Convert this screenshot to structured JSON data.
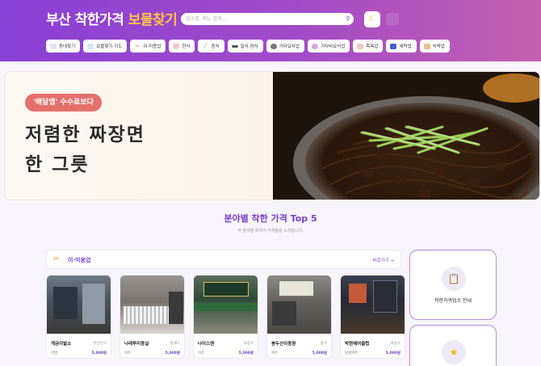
{
  "header": {
    "logo_main": "부산 착한가격",
    "logo_accent": "보물찾기",
    "search_placeholder": "업소명, 메뉴 검색...",
    "search_icon": "search-icon",
    "dark_mode_icon": "moon-icon"
  },
  "categories": [
    {
      "label": "동네찾기",
      "icon": "map-icon",
      "color": "#7b8fd6"
    },
    {
      "label": "보물찾기 지도",
      "icon": "treasure-map-icon",
      "color": "#5a9be6"
    },
    {
      "label": "이·미용업",
      "icon": "scissors-icon",
      "color": "#e69a2e"
    },
    {
      "label": "한식",
      "icon": "rice-bowl-icon",
      "color": "#d05a5a"
    },
    {
      "label": "중식",
      "icon": "chopsticks-icon",
      "color": "#d06f9b"
    },
    {
      "label": "일식·양식",
      "icon": "plate-icon",
      "color": "#5a5a5a"
    },
    {
      "label": "기타요식업",
      "icon": "dish-icon",
      "color": "#6a6a6a"
    },
    {
      "label": "기타비요식업",
      "icon": "shop-icon",
      "color": "#b06ac0"
    },
    {
      "label": "목욕업",
      "icon": "bath-icon",
      "color": "#d68a8a"
    },
    {
      "label": "세탁업",
      "icon": "laundry-icon",
      "color": "#4a5ad0"
    },
    {
      "label": "숙박업",
      "icon": "bed-icon",
      "color": "#c07a3a"
    }
  ],
  "hero": {
    "badge": "'배달앱' 수수료보다",
    "title_line1": "저렴한 짜장면",
    "title_line2": "한 그릇"
  },
  "section": {
    "title": "분야별 착한 가격 Top 5",
    "subtitle": "각 분야별 최저가 가게들을 소개합니다."
  },
  "panel": {
    "icon": "scissors-icon",
    "label": "이·미용업",
    "more": "바로가기 →"
  },
  "cards": [
    {
      "name": "개금이발소",
      "area": "부산진구",
      "item": "이발",
      "price": "5,000원"
    },
    {
      "name": "나래투미용실",
      "area": "중세구",
      "item": "커트",
      "price": "5,000원"
    },
    {
      "name": "나이스맨",
      "area": "사상구",
      "item": "커트",
      "price": "5,000원"
    },
    {
      "name": "봉두산이용원",
      "area": "중구",
      "item": "커트",
      "price": "5,000원"
    },
    {
      "name": "박현헤어클럽",
      "area": "사상구",
      "item": "남성커트",
      "price": "5,000원"
    }
  ],
  "side": [
    {
      "icon": "clipboard-icon",
      "label": "착한가격업소 안내"
    },
    {
      "icon": "star-icon",
      "label": ""
    }
  ],
  "colors": {
    "brand": "#8a3fd6",
    "accent": "#ffc24a",
    "badge": "#e4706c"
  }
}
